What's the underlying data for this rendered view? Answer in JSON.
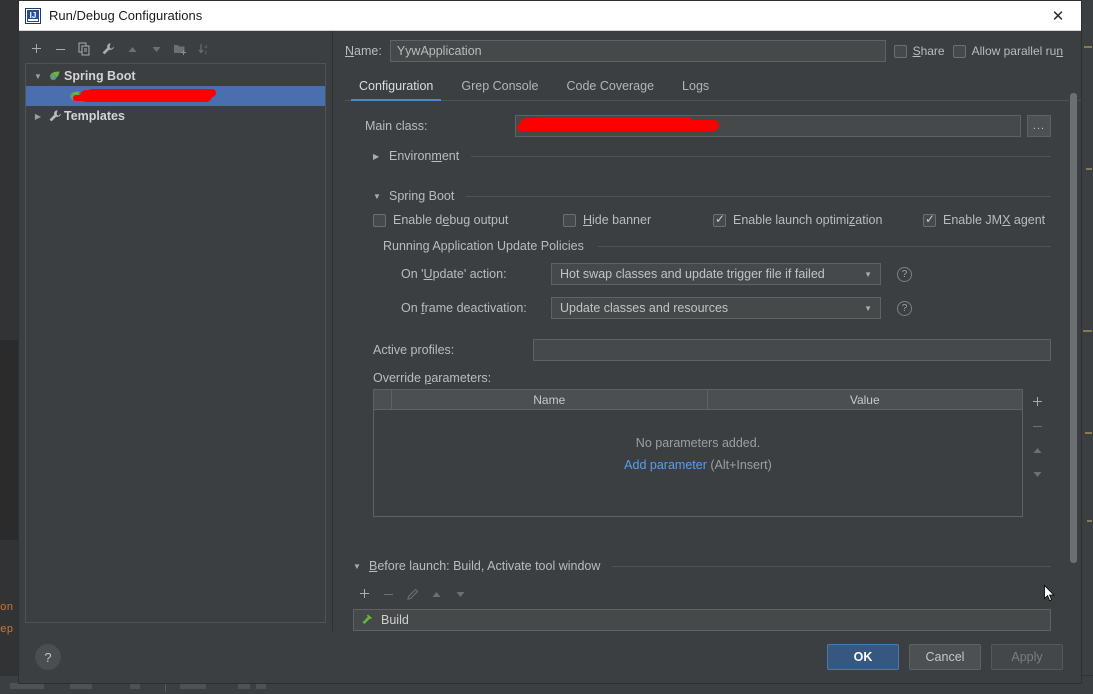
{
  "window": {
    "title": "Run/Debug Configurations",
    "app_icon": "intellij-idea-icon",
    "close_label": "✕"
  },
  "tree_toolbar": {
    "buttons": [
      {
        "name": "add-configuration-button",
        "icon": "plus-icon",
        "glyph": "✚",
        "enabled": true
      },
      {
        "name": "remove-configuration-button",
        "icon": "minus-icon",
        "glyph": "─",
        "enabled": true
      },
      {
        "name": "copy-configuration-button",
        "icon": "copy-icon",
        "glyph": "❐",
        "enabled": true
      },
      {
        "name": "edit-templates-button",
        "icon": "wrench-icon",
        "glyph": "🔧",
        "enabled": true
      },
      {
        "name": "move-up-button",
        "icon": "arrow-up-icon",
        "glyph": "▲",
        "enabled": false
      },
      {
        "name": "move-down-button",
        "icon": "arrow-down-icon",
        "glyph": "▼",
        "enabled": false
      },
      {
        "name": "new-folder-button",
        "icon": "folder-add-icon",
        "glyph": "🗀",
        "enabled": false
      },
      {
        "name": "sort-configurations-button",
        "icon": "sort-alpha-icon",
        "glyph": "↓",
        "enabled": false
      }
    ]
  },
  "tree": {
    "items": [
      {
        "label": "Spring Boot",
        "icon": "spring-boot-leaf-icon",
        "twisty": "▼",
        "level": 0,
        "selected": false,
        "redacted": false
      },
      {
        "label": "",
        "icon": "spring-boot-leaf-icon",
        "twisty": "",
        "level": 1,
        "selected": true,
        "redacted": true
      },
      {
        "label": "Templates",
        "icon": "wrench-icon",
        "twisty": "▶",
        "level": 0,
        "selected": false,
        "redacted": false
      }
    ]
  },
  "name_row": {
    "label": "Name:",
    "label_mnemonic": "N",
    "value": "YywApplication",
    "share": {
      "label": "Share",
      "mnemonic": "S",
      "checked": false
    },
    "allow_parallel": {
      "label": "Allow parallel run",
      "mnemonic": "n",
      "checked": false
    }
  },
  "tabs": [
    {
      "label": "Configuration",
      "active": true
    },
    {
      "label": "Grep Console",
      "active": false
    },
    {
      "label": "Code Coverage",
      "active": false
    },
    {
      "label": "Logs",
      "active": false
    }
  ],
  "form": {
    "main_class": {
      "label": "Main class:",
      "value": "",
      "redacted": true,
      "browse_label": "..."
    },
    "environment_section": {
      "label": "Environment",
      "twisty": "▶",
      "expanded": false
    },
    "spring_boot_section": {
      "label": "Spring Boot",
      "twisty": "▼",
      "expanded": true,
      "checkboxes": [
        {
          "label": "Enable debug output",
          "checked": false,
          "name": "enable-debug-output-checkbox"
        },
        {
          "label": "Hide banner",
          "checked": false,
          "name": "hide-banner-checkbox"
        },
        {
          "label": "Enable launch optimization",
          "checked": true,
          "name": "enable-launch-optimization-checkbox"
        },
        {
          "label": "Enable JMX agent",
          "checked": true,
          "name": "enable-jmx-agent-checkbox"
        }
      ]
    },
    "update_policies": {
      "label": "Running Application Update Policies",
      "on_update": {
        "label": "On 'Update' action:",
        "value": "Hot swap classes and update trigger file if failed",
        "help": "?"
      },
      "on_frame_deactivation": {
        "label": "On frame deactivation:",
        "value": "Update classes and resources",
        "help": "?"
      }
    },
    "active_profiles": {
      "label": "Active profiles:",
      "value": ""
    },
    "override_parameters": {
      "label": "Override parameters:",
      "columns": [
        "",
        "Name",
        "Value"
      ],
      "rows": [],
      "empty_text": "No parameters added.",
      "add_link_text": "Add parameter",
      "add_shortcut_text": " (Alt+Insert)",
      "side_buttons": [
        {
          "name": "add-parameter-button",
          "icon": "plus-icon",
          "glyph": "✚",
          "enabled": true
        },
        {
          "name": "remove-parameter-button",
          "icon": "minus-icon",
          "glyph": "─",
          "enabled": false
        },
        {
          "name": "move-parameter-up-button",
          "icon": "arrow-up-icon",
          "glyph": "▲",
          "enabled": false
        },
        {
          "name": "move-parameter-down-button",
          "icon": "arrow-down-icon",
          "glyph": "▼",
          "enabled": false
        }
      ]
    }
  },
  "before_launch": {
    "header": "Before launch: Build, Activate tool window",
    "twisty": "▼",
    "toolbar": [
      {
        "name": "add-before-launch-task-button",
        "icon": "plus-icon",
        "glyph": "✚",
        "enabled": true
      },
      {
        "name": "remove-before-launch-task-button",
        "icon": "minus-icon",
        "glyph": "─",
        "enabled": false
      },
      {
        "name": "edit-before-launch-task-button",
        "icon": "pencil-icon",
        "glyph": "✎",
        "enabled": false
      },
      {
        "name": "move-task-up-button",
        "icon": "arrow-up-icon",
        "glyph": "▲",
        "enabled": false
      },
      {
        "name": "move-task-down-button",
        "icon": "arrow-down-icon",
        "glyph": "▼",
        "enabled": false
      }
    ],
    "items": [
      {
        "label": "Build",
        "icon": "build-hammer-icon"
      }
    ]
  },
  "footer": {
    "help_label": "?",
    "ok_label": "OK",
    "cancel_label": "Cancel",
    "apply_label": "Apply",
    "apply_enabled": false
  },
  "colors": {
    "dialog_bg": "#3c3f41",
    "titlebar_bg": "#ffffff",
    "selection_blue": "#4b6eaf",
    "accent_blue": "#4a88c7",
    "link_blue": "#589df6",
    "ok_button": "#365880",
    "redaction_red": "#ff0000",
    "build_icon_green": "#62b543",
    "text_primary": "#bbbbbb"
  }
}
